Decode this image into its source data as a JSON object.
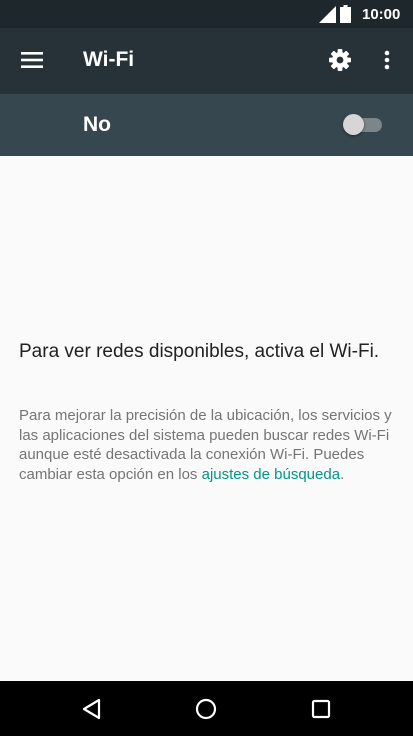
{
  "status_bar": {
    "time": "10:00"
  },
  "app_bar": {
    "title": "Wi-Fi"
  },
  "wifi_toggle": {
    "label": "No",
    "enabled": false
  },
  "content": {
    "headline": "Para ver redes disponibles, activa el Wi-Fi.",
    "description": "Para mejorar la precisión de la ubicación, los servicios y las aplicaciones del sistema pueden buscar redes Wi-Fi aunque esté desactivada la conexión Wi-Fi. Puedes cambiar esta opción en los",
    "link_text": "ajustes de búsqueda",
    "trailing": "."
  },
  "colors": {
    "status_bar": "#1e272c",
    "app_bar": "#263238",
    "toggle_bar": "#37474f",
    "link": "#009688"
  },
  "icons": {
    "status": [
      "signal-icon",
      "battery-icon"
    ],
    "app_bar": [
      "menu-icon",
      "settings-gear-icon",
      "more-vert-icon"
    ],
    "nav_bar": [
      "back-icon",
      "home-icon",
      "recents-icon"
    ]
  }
}
